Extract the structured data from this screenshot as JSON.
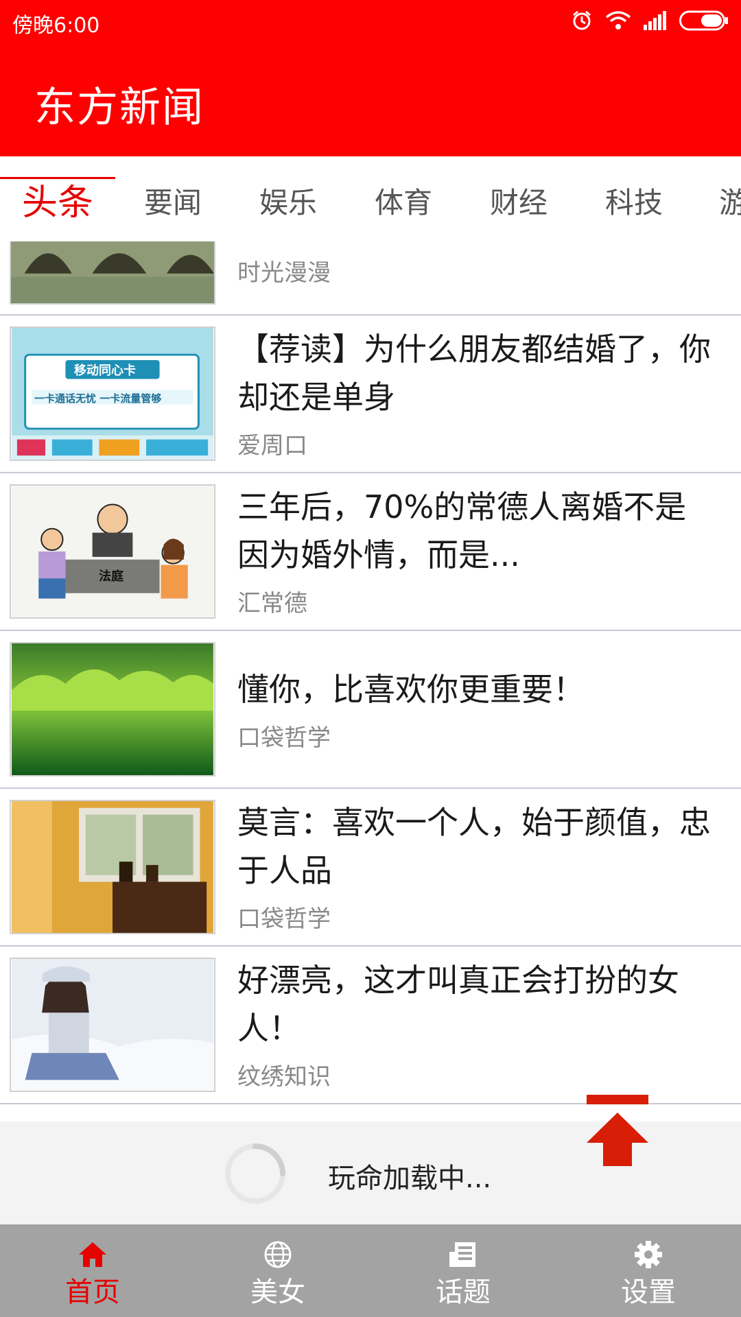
{
  "status_bar": {
    "time": "傍晚6:00"
  },
  "app_bar": {
    "title": "东方新闻"
  },
  "tabs": [
    {
      "label": "头条",
      "active": true
    },
    {
      "label": "要闻",
      "active": false
    },
    {
      "label": "娱乐",
      "active": false
    },
    {
      "label": "体育",
      "active": false
    },
    {
      "label": "财经",
      "active": false
    },
    {
      "label": "科技",
      "active": false
    },
    {
      "label": "游",
      "active": false
    }
  ],
  "news": [
    {
      "title": "",
      "source": "时光漫漫",
      "thumb": "bridge-river-image"
    },
    {
      "title": "【荐读】为什么朋友都结婚了，你却还是单身",
      "source": "爱周口",
      "thumb": "mobile-card-ad-image",
      "thumb_text": "移动同心卡",
      "thumb_sub": "一卡通话无忧 一卡流量管够"
    },
    {
      "title": "三年后，70%的常德人离婚不是因为婚外情，而是...",
      "source": "汇常德",
      "thumb": "court-cartoon-image",
      "thumb_text": "法庭"
    },
    {
      "title": "懂你，比喜欢你更重要！",
      "source": "口袋哲学",
      "thumb": "green-lake-image"
    },
    {
      "title": "莫言：喜欢一个人，始于颜值，忠于人品",
      "source": "口袋哲学",
      "thumb": "window-room-image"
    },
    {
      "title": "好漂亮，这才叫真正会打扮的女人！",
      "source": "纹绣知识",
      "thumb": "snow-girl-image"
    }
  ],
  "loading": {
    "text": "玩命加载中..."
  },
  "bottom_nav": [
    {
      "label": "首页",
      "icon": "home-icon",
      "active": true
    },
    {
      "label": "美女",
      "icon": "globe-icon",
      "active": false
    },
    {
      "label": "话题",
      "icon": "newspaper-icon",
      "active": false
    },
    {
      "label": "设置",
      "icon": "gear-icon",
      "active": false
    }
  ],
  "colors": {
    "primary": "#fe0000",
    "active_text": "#e60000",
    "nav_bg": "#a3a3a3"
  }
}
